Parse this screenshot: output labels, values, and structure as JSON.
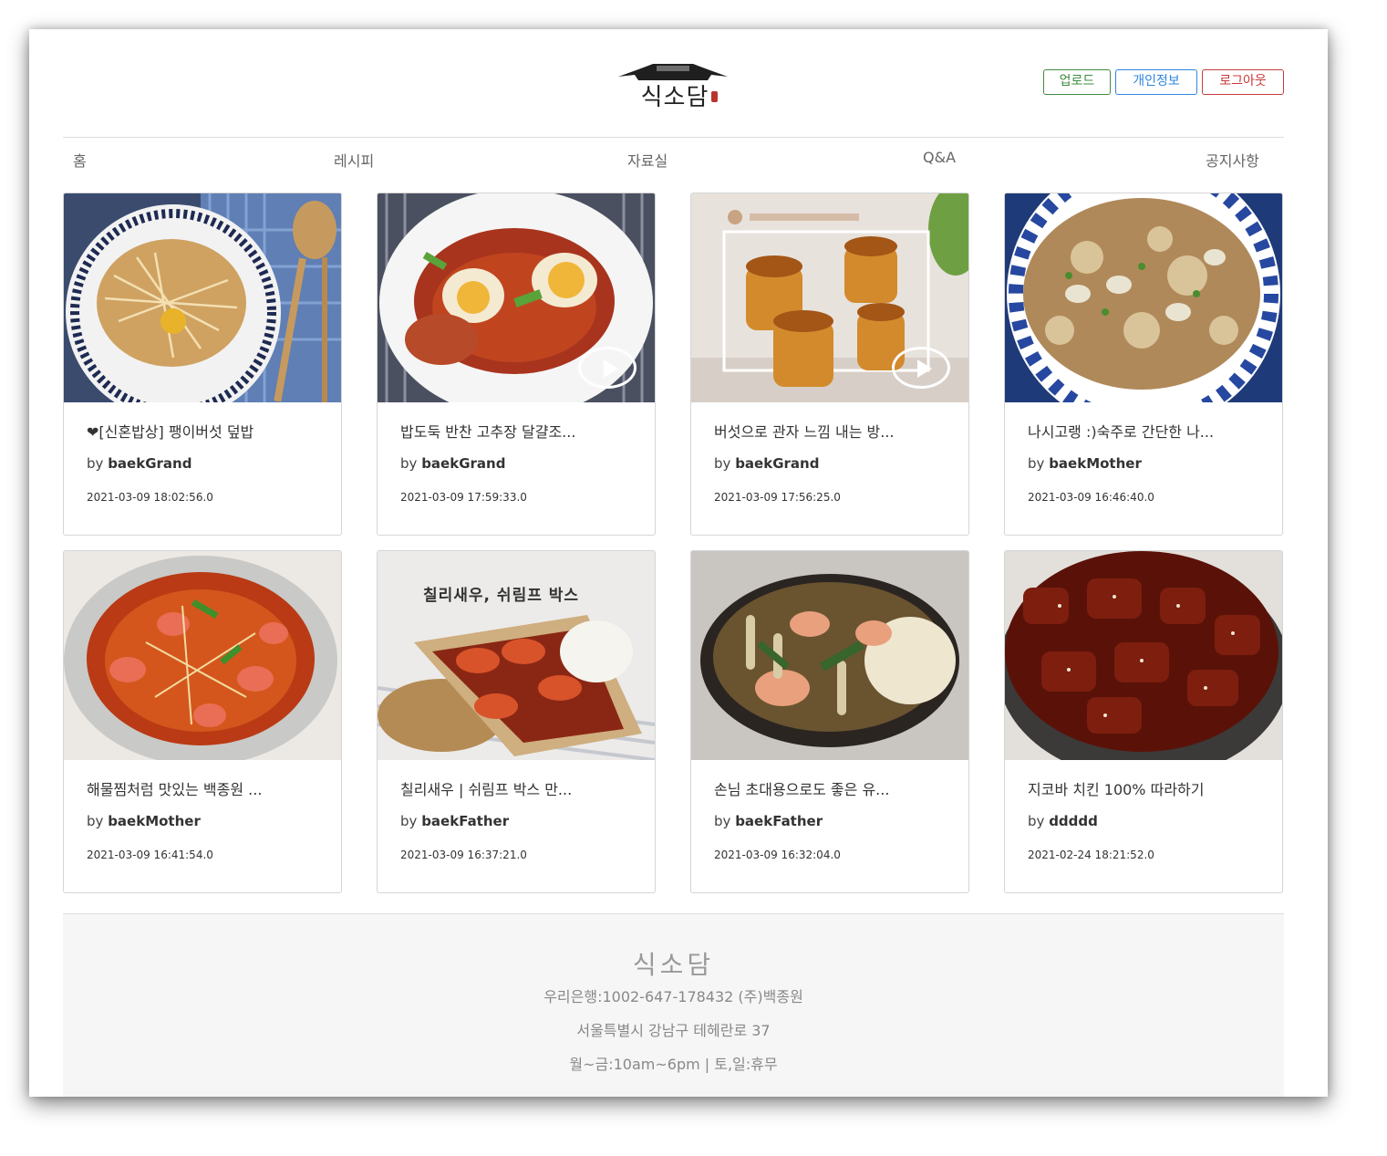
{
  "header": {
    "logo_text": "식소담",
    "buttons": {
      "upload": "업로드",
      "profile": "개인정보",
      "logout": "로그아웃"
    }
  },
  "nav": [
    "홈",
    "레시피",
    "자료실",
    "Q&A",
    "공지사항"
  ],
  "cards": [
    {
      "title": "❤[신혼밥상] 팽이버섯 덮밥",
      "by": "by",
      "author": "baekGrand",
      "date": "2021-03-09 18:02:56.0"
    },
    {
      "title": "밥도둑 반찬 고추장 달걀조...",
      "by": "by",
      "author": "baekGrand",
      "date": "2021-03-09 17:59:33.0"
    },
    {
      "title": "버섯으로 관자 느낌 내는 방...",
      "by": "by",
      "author": "baekGrand",
      "date": "2021-03-09 17:56:25.0"
    },
    {
      "title": "나시고랭 :)숙주로 간단한 나...",
      "by": "by",
      "author": "baekMother",
      "date": "2021-03-09 16:46:40.0"
    },
    {
      "title": "해물찜처럼 맛있는 백종원 ...",
      "by": "by",
      "author": "baekMother",
      "date": "2021-03-09 16:41:54.0"
    },
    {
      "title": "칠리새우 | 쉬림프 박스 만...",
      "by": "by",
      "author": "baekFather",
      "date": "2021-03-09 16:37:21.0"
    },
    {
      "title": "손님 초대용으로도 좋은 유...",
      "by": "by",
      "author": "baekFather",
      "date": "2021-03-09 16:32:04.0"
    },
    {
      "title": "지코바 치킨 100% 따라하기",
      "by": "by",
      "author": "ddddd",
      "date": "2021-02-24 18:21:52.0"
    }
  ],
  "image_overlay": {
    "shrimp_caption": "칠리새우, 쉬림프 박스"
  },
  "footer": {
    "name": "식소담",
    "bank": "우리은행:1002-647-178432 (주)백종원",
    "address": "서울특별시 강남구 테헤란로 37",
    "hours": "월~금:10am~6pm | 토,일:휴무"
  },
  "colors": {
    "upload": "#3e8e41",
    "profile": "#2f86dd",
    "logout": "#c83b3b"
  }
}
